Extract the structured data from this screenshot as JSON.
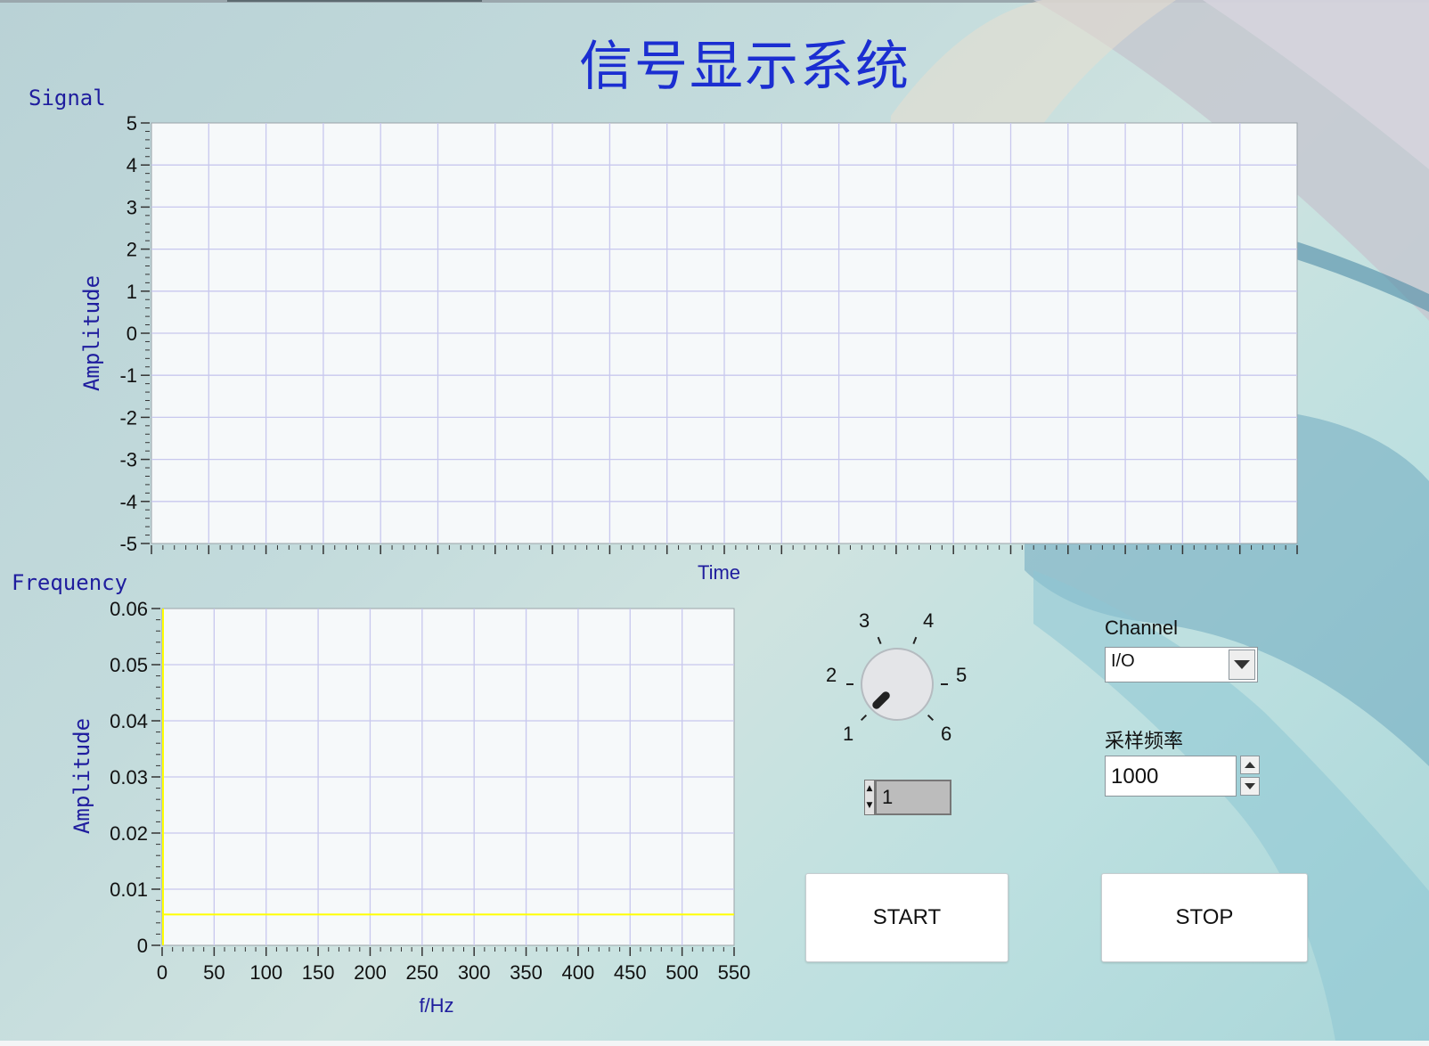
{
  "title": "信号显示系统",
  "signal_graph": {
    "label": "Signal",
    "xlabel": "Time",
    "ylabel": "Amplitude",
    "y_ticks": [
      "5",
      "4",
      "3",
      "2",
      "1",
      "0",
      "-1",
      "-2",
      "-3",
      "-4",
      "-5"
    ]
  },
  "frequency_graph": {
    "label": "Frequency",
    "xlabel": "f/Hz",
    "ylabel": "Amplitude",
    "y_ticks": [
      "0.06",
      "0.05",
      "0.04",
      "0.03",
      "0.02",
      "0.01",
      "0"
    ],
    "x_ticks": [
      "0",
      "50",
      "100",
      "150",
      "200",
      "250",
      "300",
      "350",
      "400",
      "450",
      "500",
      "550"
    ]
  },
  "chart_data": [
    {
      "type": "line",
      "title": "Signal",
      "xlabel": "Time",
      "ylabel": "Amplitude",
      "ylim": [
        -5,
        5
      ],
      "grid": true,
      "series": []
    },
    {
      "type": "line",
      "title": "Frequency",
      "xlabel": "f/Hz",
      "ylabel": "Amplitude",
      "xlim": [
        0,
        550
      ],
      "ylim": [
        0,
        0.06
      ],
      "grid": true,
      "series": [
        {
          "color": "#ffff00",
          "x": [
            0,
            550
          ],
          "y": [
            0.0055,
            0.0055
          ]
        }
      ]
    }
  ],
  "knob": {
    "labels": [
      "1",
      "2",
      "3",
      "4",
      "5",
      "6"
    ],
    "value": 1,
    "min": 1,
    "max": 6,
    "display_value": "1"
  },
  "channel": {
    "label": "Channel",
    "value": "I/O"
  },
  "sample_rate": {
    "label": "采样频率",
    "value": "1000"
  },
  "buttons": {
    "start": "START",
    "stop": "STOP"
  },
  "colors": {
    "title": "#1b2ed1",
    "axis_label": "#1f1d9e",
    "grid": "#c8c8ee",
    "plot_bg": "#f6f9fa",
    "trace": "#ffff00"
  },
  "icons": {
    "dropdown": "chevron-down-icon",
    "spin_up": "triangle-up-icon",
    "spin_down": "triangle-down-icon"
  }
}
